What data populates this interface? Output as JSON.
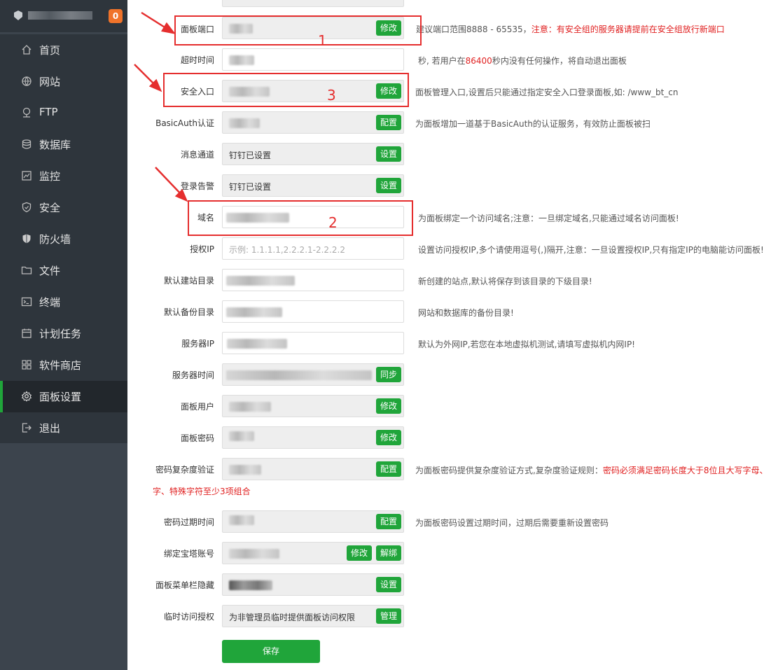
{
  "sidebar": {
    "badge": "0",
    "items": [
      {
        "label": "首页",
        "icon": "home-icon"
      },
      {
        "label": "网站",
        "icon": "globe-icon"
      },
      {
        "label": "FTP",
        "icon": "ftp-icon"
      },
      {
        "label": "数据库",
        "icon": "database-icon"
      },
      {
        "label": "监控",
        "icon": "monitor-icon"
      },
      {
        "label": "安全",
        "icon": "shield-icon"
      },
      {
        "label": "防火墙",
        "icon": "firewall-icon"
      },
      {
        "label": "文件",
        "icon": "folder-icon"
      },
      {
        "label": "终端",
        "icon": "terminal-icon"
      },
      {
        "label": "计划任务",
        "icon": "calendar-icon"
      },
      {
        "label": "软件商店",
        "icon": "apps-icon"
      },
      {
        "label": "面板设置",
        "icon": "gear-icon"
      },
      {
        "label": "退出",
        "icon": "logout-icon"
      }
    ],
    "active": "面板设置"
  },
  "settings": {
    "panel_port": {
      "label": "面板端口",
      "button": "修改",
      "tip": "建议端口范围8888 - 65535，",
      "tip_warn": "注意：有安全组的服务器请提前在安全组放行新端口"
    },
    "timeout": {
      "label": "超时时间",
      "tip_pre": "秒, 若用户在",
      "tip_num": "86400",
      "tip_post": "秒内没有任何操作，将自动退出面板"
    },
    "security_entry": {
      "label": "安全入口",
      "button": "修改",
      "tip": "面板管理入口,设置后只能通过指定安全入口登录面板,如: /www_bt_cn"
    },
    "basic_auth": {
      "label": "BasicAuth认证",
      "button": "配置",
      "tip": "为面板增加一道基于BasicAuth的认证服务，有效防止面板被扫"
    },
    "message_channel": {
      "label": "消息通道",
      "value": "钉钉已设置",
      "button": "设置"
    },
    "login_alert": {
      "label": "登录告警",
      "value": "钉钉已设置",
      "button": "设置"
    },
    "domain": {
      "label": "域名",
      "tip": "为面板绑定一个访问域名;注意：一旦绑定域名,只能通过域名访问面板!"
    },
    "auth_ip": {
      "label": "授权IP",
      "placeholder": "示例: 1.1.1.1,2.2.2.1-2.2.2.2",
      "tip": "设置访问授权IP,多个请使用逗号(,)隔开,注意：一旦设置授权IP,只有指定IP的电脑能访问面板!"
    },
    "default_site_dir": {
      "label": "默认建站目录",
      "tip": "新创建的站点,默认将保存到该目录的下级目录!"
    },
    "default_backup_dir": {
      "label": "默认备份目录",
      "tip": "网站和数据库的备份目录!"
    },
    "server_ip": {
      "label": "服务器IP",
      "tip": "默认为外网IP,若您在本地虚拟机测试,请填写虚拟机内网IP!"
    },
    "server_time": {
      "label": "服务器时间",
      "button": "同步"
    },
    "panel_user": {
      "label": "面板用户",
      "button": "修改"
    },
    "panel_password": {
      "label": "面板密码",
      "button": "修改"
    },
    "password_complexity": {
      "label": "密码复杂度验证",
      "button": "配置",
      "tip": "为面板密码提供复杂度验证方式,复杂度验证规则：",
      "tip_warn": "密码必须满足密码长度大于8位且大写字母、",
      "tip_warn2": "字、特殊字符至少3项组合"
    },
    "password_expire": {
      "label": "密码过期时间",
      "button": "配置",
      "tip": "为面板密码设置过期时间，过期后需要重新设置密码"
    },
    "bind_account": {
      "label": "绑定宝塔账号",
      "button1": "修改",
      "button2": "解绑"
    },
    "menu_hide": {
      "label": "面板菜单栏隐藏",
      "button": "设置"
    },
    "temp_access": {
      "label": "临时访问授权",
      "value": "为非管理员临时提供面板访问权限",
      "button": "管理"
    },
    "save": "保存"
  },
  "annotations": {
    "n1": "1",
    "n2": "2",
    "n3": "3"
  }
}
